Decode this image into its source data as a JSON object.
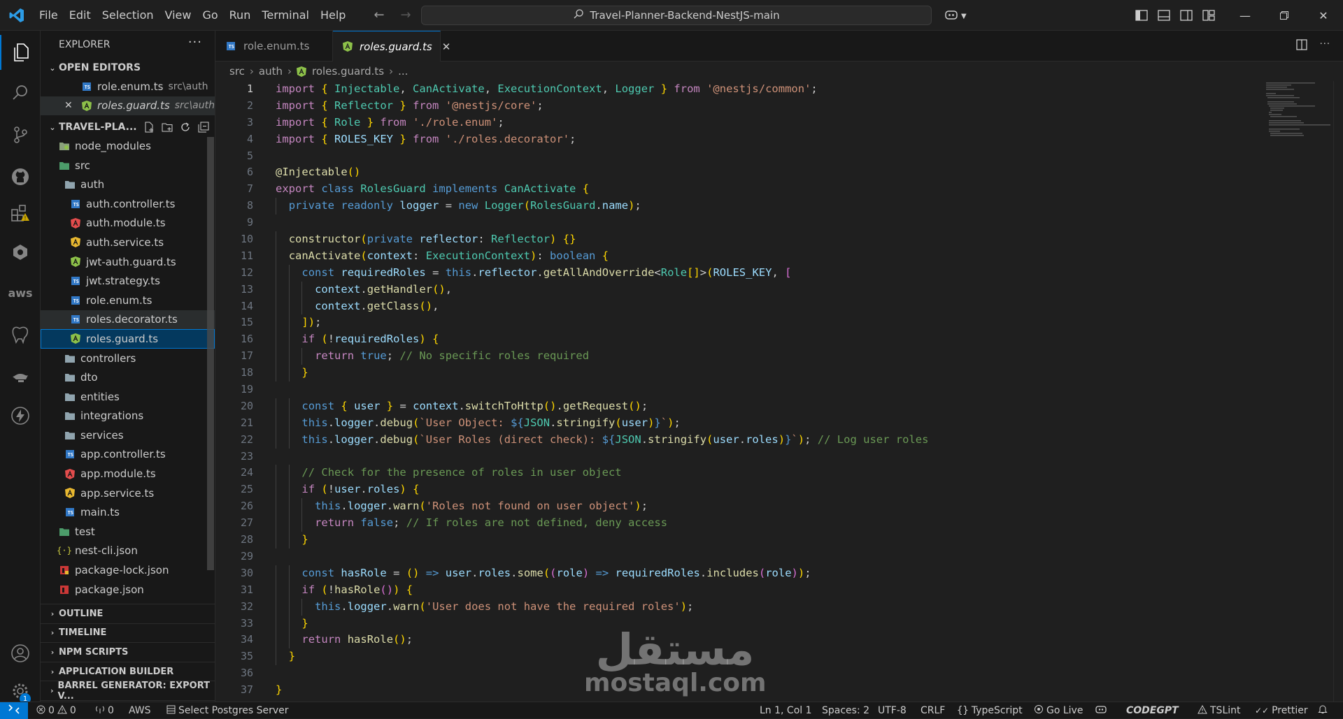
{
  "window": {
    "menu": [
      "File",
      "Edit",
      "Selection",
      "View",
      "Go",
      "Run",
      "Terminal",
      "Help"
    ],
    "search_text": "Travel-Planner-Backend-NestJS-main"
  },
  "sidebar": {
    "title": "EXPLORER",
    "open_editors_label": "OPEN EDITORS",
    "open_editors": [
      {
        "name": "role.enum.ts",
        "path": "src\\auth"
      },
      {
        "name": "roles.guard.ts",
        "path": "src\\auth"
      }
    ],
    "project_label": "TRAVEL-PLA...",
    "tree": [
      {
        "name": "node_modules",
        "icon": "folder-node"
      },
      {
        "name": "src",
        "icon": "folder-src"
      },
      {
        "name": "auth",
        "icon": "folder"
      },
      {
        "name": "auth.controller.ts",
        "icon": "ts"
      },
      {
        "name": "auth.module.ts",
        "icon": "angular-red"
      },
      {
        "name": "auth.service.ts",
        "icon": "angular-yellow"
      },
      {
        "name": "jwt-auth.guard.ts",
        "icon": "angular-green"
      },
      {
        "name": "jwt.strategy.ts",
        "icon": "ts"
      },
      {
        "name": "role.enum.ts",
        "icon": "ts"
      },
      {
        "name": "roles.decorator.ts",
        "icon": "ts"
      },
      {
        "name": "roles.guard.ts",
        "icon": "angular-green"
      },
      {
        "name": "controllers",
        "icon": "folder"
      },
      {
        "name": "dto",
        "icon": "folder"
      },
      {
        "name": "entities",
        "icon": "folder"
      },
      {
        "name": "integrations",
        "icon": "folder"
      },
      {
        "name": "services",
        "icon": "folder"
      },
      {
        "name": "app.controller.ts",
        "icon": "ts"
      },
      {
        "name": "app.module.ts",
        "icon": "angular-red"
      },
      {
        "name": "app.service.ts",
        "icon": "angular-yellow"
      },
      {
        "name": "main.ts",
        "icon": "ts"
      },
      {
        "name": "test",
        "icon": "folder-test"
      },
      {
        "name": "nest-cli.json",
        "icon": "json"
      },
      {
        "name": "package-lock.json",
        "icon": "npm-lock"
      },
      {
        "name": "package.json",
        "icon": "npm"
      }
    ],
    "bottom_sections": [
      "OUTLINE",
      "TIMELINE",
      "NPM SCRIPTS",
      "APPLICATION BUILDER",
      "BARREL GENERATOR: EXPORT V..."
    ]
  },
  "activity_bar": {
    "accounts_badge": "1"
  },
  "editor": {
    "tabs": [
      {
        "label": "role.enum.ts",
        "active": false
      },
      {
        "label": "roles.guard.ts",
        "active": true
      }
    ],
    "breadcrumb": [
      "src",
      "auth",
      "roles.guard.ts",
      "..."
    ],
    "line_numbers": [
      "1",
      "2",
      "3",
      "4",
      "5",
      "6",
      "7",
      "8",
      "9",
      "10",
      "11",
      "12",
      "13",
      "14",
      "15",
      "16",
      "17",
      "18",
      "19",
      "20",
      "21",
      "22",
      "23",
      "24",
      "25",
      "26",
      "27",
      "28",
      "29",
      "30",
      "31",
      "32",
      "33",
      "34",
      "35",
      "36",
      "37"
    ],
    "lines": [
      "import { Injectable, CanActivate, ExecutionContext, Logger } from '@nestjs/common';",
      "import { Reflector } from '@nestjs/core';",
      "import { Role } from './role.enum';",
      "import { ROLES_KEY } from './roles.decorator';",
      "",
      "@Injectable()",
      "export class RolesGuard implements CanActivate {",
      "  private readonly logger = new Logger(RolesGuard.name);",
      "",
      "  constructor(private reflector: Reflector) {}",
      "  canActivate(context: ExecutionContext): boolean {",
      "    const requiredRoles = this.reflector.getAllAndOverride<Role[]>(ROLES_KEY, [",
      "      context.getHandler(),",
      "      context.getClass(),",
      "    ]);",
      "    if (!requiredRoles) {",
      "      return true; // No specific roles required",
      "    }",
      "",
      "    const { user } = context.switchToHttp().getRequest();",
      "    this.logger.debug(`User Object: ${JSON.stringify(user)}`);",
      "    this.logger.debug(`User Roles (direct check): ${JSON.stringify(user.roles)}`); // Log user roles",
      "",
      "    // Check for the presence of roles in user object",
      "    if (!user.roles) {",
      "      this.logger.warn('Roles not found on user object');",
      "      return false; // If roles are not defined, deny access",
      "    }",
      "",
      "    const hasRole = () => user.roles.some((role) => requiredRoles.includes(role));",
      "    if (!hasRole()) {",
      "      this.logger.warn('User does not have the required roles');",
      "    }",
      "    return hasRole();",
      "  }",
      "",
      "}"
    ]
  },
  "watermark": {
    "arabic": "مستقل",
    "latin": "mostaql.com"
  },
  "statusbar": {
    "errors": "0",
    "warnings": "0",
    "ports": "0",
    "aws": "AWS",
    "postgres": "Select Postgres Server",
    "position": "Ln 1, Col 1",
    "spaces": "Spaces: 2",
    "encoding": "UTF-8",
    "eol": "CRLF",
    "language": "TypeScript",
    "golive": "Go Live",
    "codegpt": "CODEGPT",
    "tslint": "TSLint",
    "prettier": "Prettier"
  },
  "colors": {
    "accent": "#0078d4",
    "background": "#1f1f1f",
    "sidebar": "#181818"
  }
}
